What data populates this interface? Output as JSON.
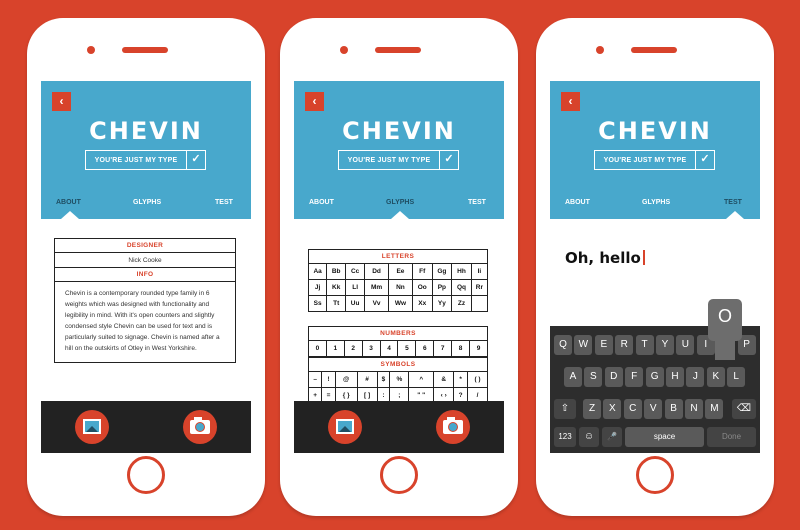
{
  "app": {
    "brand": "CHEVIN",
    "tagline": "YOU'RE JUST MY TYPE",
    "check_icon": "✓",
    "back_icon": "‹",
    "tabs": [
      "ABOUT",
      "GLYPHS",
      "TEST"
    ]
  },
  "about": {
    "designer_heading": "DESIGNER",
    "designer_name": "Nick Cooke",
    "info_heading": "INFO",
    "info_text": "Chevin is a contemporary rounded type family in 6 weights which was designed with functionality and legibility in mind. With it's open counters and slightly condensed style Chevin can be used for text and is particularly suited to signage. Chevin is named after a hill on the outskirts of Otley in West Yorkshire."
  },
  "glyphs": {
    "letters_heading": "LETTERS",
    "letters": [
      [
        "Aa",
        "Bb",
        "Cc",
        "Dd",
        "Ee",
        "Ff",
        "Gg",
        "Hh",
        "Ii"
      ],
      [
        "Jj",
        "Kk",
        "Ll",
        "Mm",
        "Nn",
        "Oo",
        "Pp",
        "Qq",
        "Rr"
      ],
      [
        "Ss",
        "Tt",
        "Uu",
        "Vv",
        "Ww",
        "Xx",
        "Yy",
        "Zz",
        ""
      ]
    ],
    "numbers_heading": "NUMBERS",
    "numbers": [
      [
        "0",
        "1",
        "2",
        "3",
        "4",
        "5",
        "6",
        "7",
        "8",
        "9"
      ]
    ],
    "symbols_heading": "SYMBOLS",
    "symbols": [
      [
        "–",
        "!",
        "@",
        "#",
        "$",
        "%",
        "^",
        "&",
        "*",
        "( )"
      ],
      [
        "+",
        "=",
        "{ }",
        "[ ]",
        ":",
        ";",
        "\" \"",
        "‹ ›",
        "?",
        "/"
      ]
    ]
  },
  "test": {
    "text": "Oh, hello",
    "popup_key": "O",
    "keyboard": {
      "row1": [
        "Q",
        "W",
        "E",
        "R",
        "T",
        "Y",
        "U",
        "I",
        "O",
        "P"
      ],
      "row2": [
        "A",
        "S",
        "D",
        "F",
        "G",
        "H",
        "J",
        "K",
        "L"
      ],
      "row3": [
        "Z",
        "X",
        "C",
        "V",
        "B",
        "N",
        "M"
      ],
      "shift_icon": "⇧",
      "delete_icon": "⌫",
      "numbers_key": "123",
      "emoji_icon": "☺",
      "mic_icon": "🎤",
      "space": "space",
      "done": "Done"
    }
  },
  "icons": {
    "gallery": "image-icon",
    "camera": "camera-icon"
  }
}
